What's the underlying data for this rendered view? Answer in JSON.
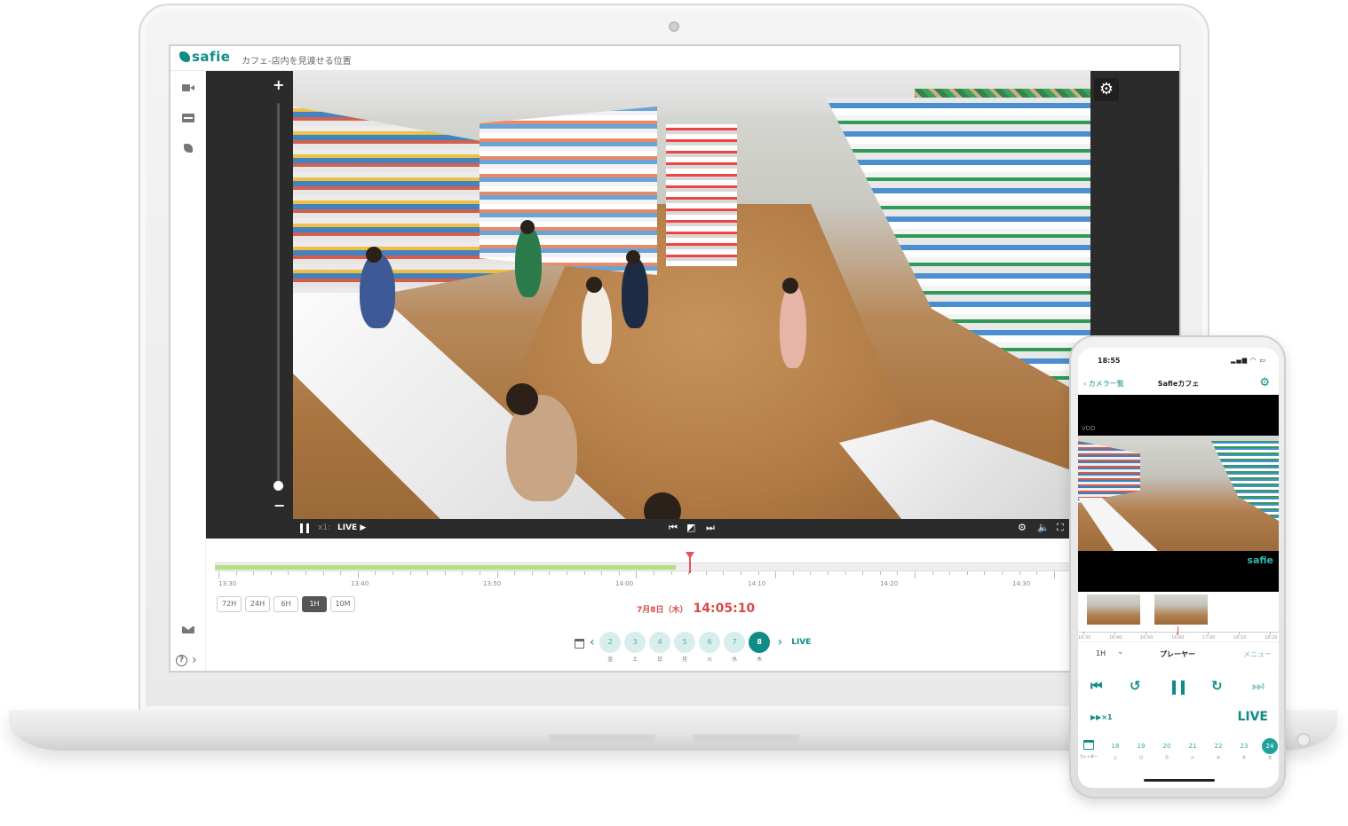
{
  "app": {
    "logo_text": "safie",
    "camera_title": "カフェ-店内を見渡せる位置"
  },
  "player": {
    "zoom_in": "+",
    "zoom_out": "−",
    "speed_label": "x1:",
    "live_label": "LIVE ▶"
  },
  "timeline": {
    "labels": [
      "13:30",
      "13:40",
      "13:50",
      "14:00",
      "14:10",
      "14:20",
      "14:30"
    ],
    "recorded_fraction": 0.54,
    "current_fraction": 0.555
  },
  "range_buttons": [
    "72H",
    "24H",
    "6H",
    "1H",
    "10M"
  ],
  "active_range": "1H",
  "current_date": "7月8日（木）",
  "current_time": "14:05:10",
  "days": [
    {
      "num": "2",
      "wk": "金"
    },
    {
      "num": "3",
      "wk": "土"
    },
    {
      "num": "4",
      "wk": "日"
    },
    {
      "num": "5",
      "wk": "月"
    },
    {
      "num": "6",
      "wk": "火"
    },
    {
      "num": "7",
      "wk": "水"
    },
    {
      "num": "8",
      "wk": "木"
    }
  ],
  "selected_day": "8",
  "live_link": "LIVE",
  "phone": {
    "time": "18:55",
    "back_label": "カメラ一覧",
    "title": "Safieカフェ",
    "vod_label": "VOD",
    "logo": "safie",
    "timeline_labels": [
      "16:30",
      "16:40",
      "16:50",
      "16:60",
      "17:00",
      "18:10",
      "18:20"
    ],
    "range": "1H",
    "tab_player": "プレーヤー",
    "tab_menu": "メニュー",
    "speed": "▶▶×1",
    "live": "LIVE",
    "calendar_label": "カレンダー",
    "days": [
      {
        "num": "18",
        "wk": "土"
      },
      {
        "num": "19",
        "wk": "日"
      },
      {
        "num": "20",
        "wk": "月"
      },
      {
        "num": "21",
        "wk": "火"
      },
      {
        "num": "22",
        "wk": "水"
      },
      {
        "num": "23",
        "wk": "木"
      },
      {
        "num": "24",
        "wk": "金"
      }
    ],
    "selected_day": "24"
  },
  "colors": {
    "brand": "#0f8c86",
    "alert": "#d84a4a",
    "recorded": "#b5dd84"
  },
  "icons": [
    "camera-icon",
    "film-icon",
    "badge-icon",
    "mail-icon",
    "help-icon",
    "gear-icon",
    "pause-icon",
    "prev-icon",
    "snapshot-icon",
    "next-icon",
    "volume-icon",
    "fullscreen-icon",
    "calendar-icon"
  ]
}
